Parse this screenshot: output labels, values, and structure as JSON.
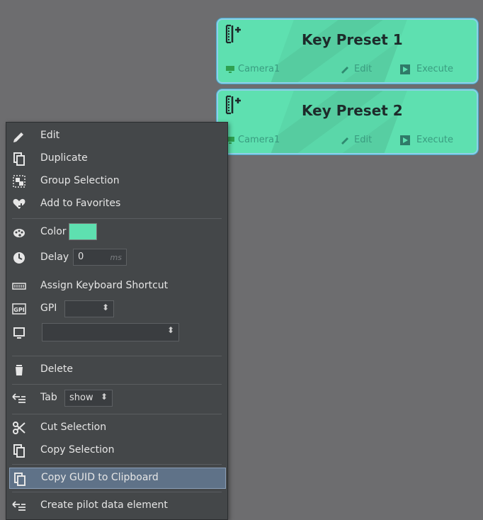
{
  "presets": [
    {
      "title": "Key Preset 1",
      "camera": "Camera1",
      "edit": "Edit",
      "execute": "Execute"
    },
    {
      "title": "Key Preset 2",
      "camera": "Camera1",
      "edit": "Edit",
      "execute": "Execute"
    }
  ],
  "menu": {
    "edit": "Edit",
    "duplicate": "Duplicate",
    "group_selection": "Group Selection",
    "add_to_favorites": "Add to Favorites",
    "color": {
      "label": "Color",
      "value": "#5ee0b0"
    },
    "delay": {
      "label": "Delay",
      "value": "0",
      "unit": "ms"
    },
    "assign_shortcut": "Assign Keyboard Shortcut",
    "gpi": {
      "label": "GPI",
      "value": ""
    },
    "screen_select": {
      "value": ""
    },
    "delete": "Delete",
    "tab": {
      "label": "Tab",
      "value": "show"
    },
    "cut_selection": "Cut Selection",
    "copy_selection": "Copy Selection",
    "copy_guid": "Copy GUID to Clipboard",
    "create_pilot": "Create pilot data element"
  },
  "colors": {
    "background": "#6d6d6f",
    "preset_fill": "#5ee0b0",
    "preset_border": "#8ed0e8",
    "menu_bg": "#444749",
    "menu_selected": "#5f7288"
  }
}
